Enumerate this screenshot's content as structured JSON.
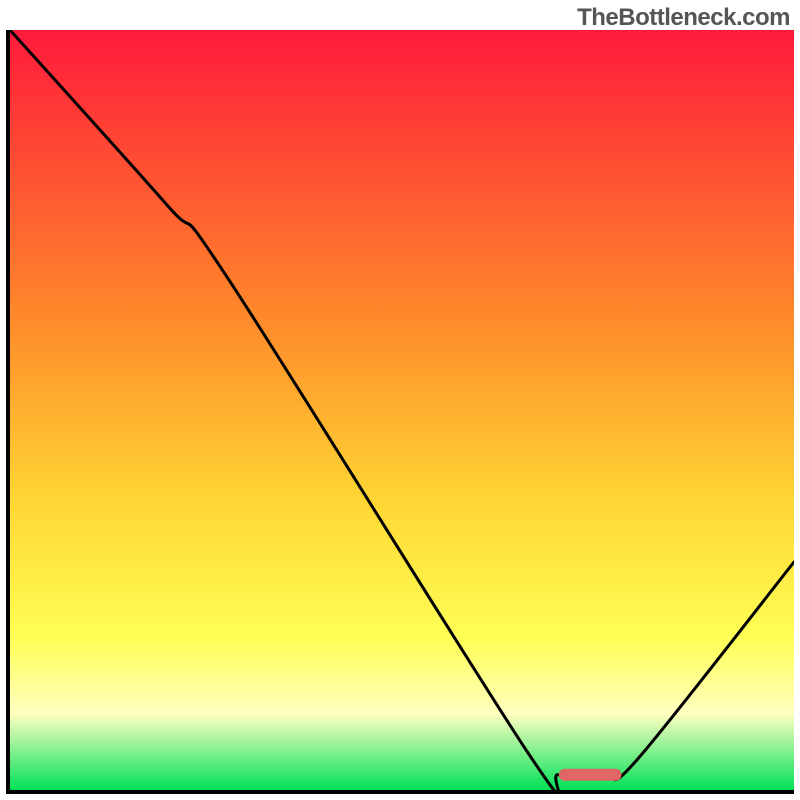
{
  "watermark": "TheBottleneck.com",
  "colors": {
    "gradient_stops": [
      {
        "offset": "0%",
        "color": "#ff1a3a"
      },
      {
        "offset": "38%",
        "color": "#ff8a2a"
      },
      {
        "offset": "62%",
        "color": "#ffd633"
      },
      {
        "offset": "80%",
        "color": "#ffff55"
      },
      {
        "offset": "90%",
        "color": "#ffffc0"
      },
      {
        "offset": "100%",
        "color": "#00e158"
      }
    ],
    "curve_stroke": "#000000",
    "marker_fill": "#e06666"
  },
  "chart_data": {
    "type": "line",
    "title": "",
    "xlabel": "",
    "ylabel": "",
    "xlim": [
      0,
      100
    ],
    "ylim": [
      0,
      100
    ],
    "curve": [
      {
        "x": 0,
        "y": 100
      },
      {
        "x": 20,
        "y": 77
      },
      {
        "x": 28,
        "y": 67
      },
      {
        "x": 66,
        "y": 5
      },
      {
        "x": 70,
        "y": 2
      },
      {
        "x": 76,
        "y": 2
      },
      {
        "x": 80,
        "y": 4
      },
      {
        "x": 100,
        "y": 30
      }
    ],
    "optimal_range": {
      "x_start": 70,
      "x_end": 78,
      "y": 2
    }
  }
}
